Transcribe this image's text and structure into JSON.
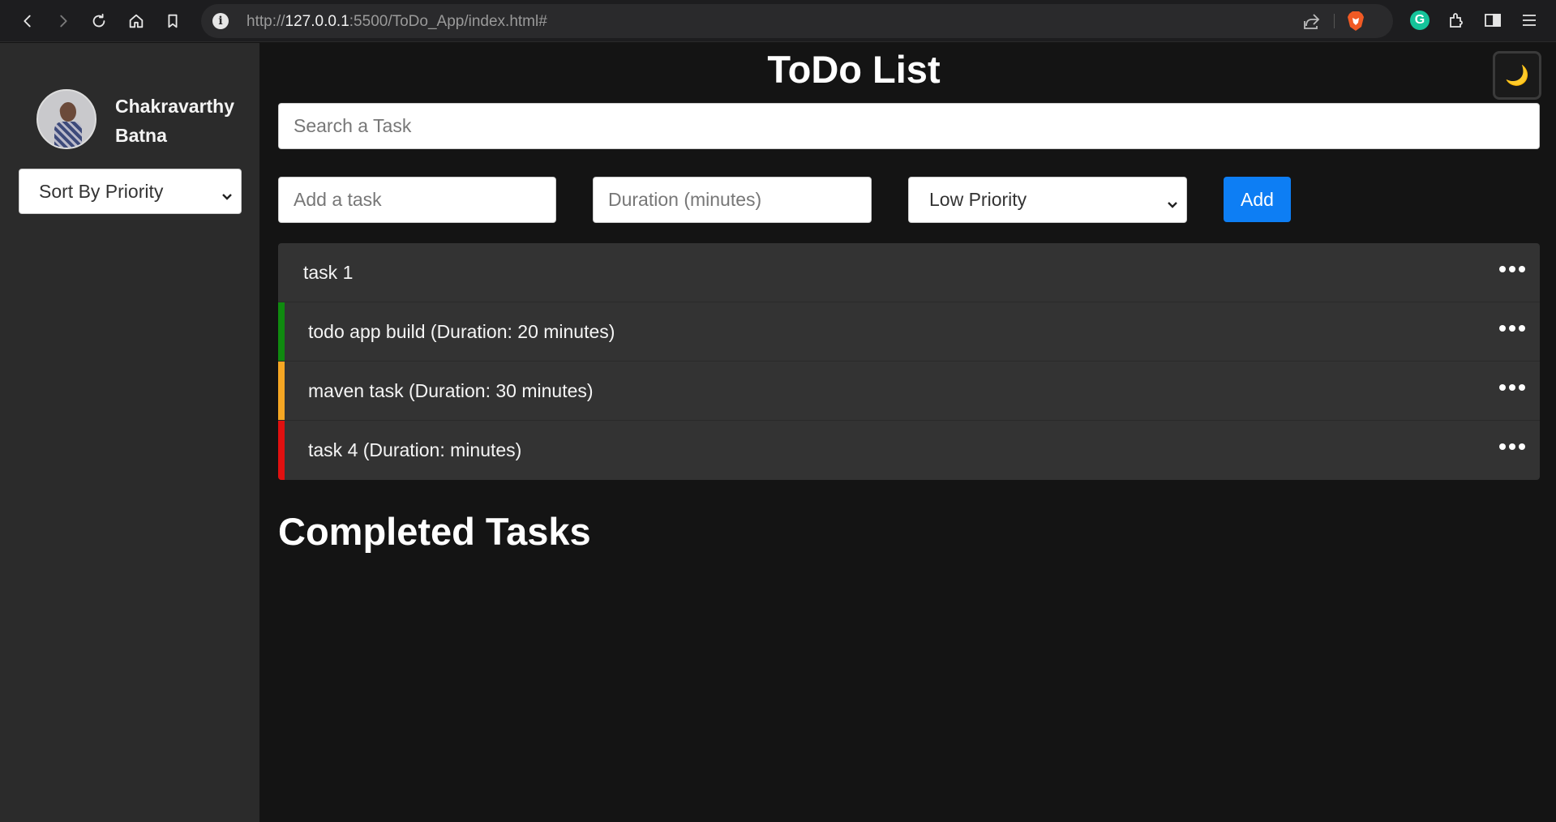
{
  "browser": {
    "url_prefix": "http://",
    "url_host": "127.0.0.1",
    "url_rest": ":5500/ToDo_App/index.html#"
  },
  "sidebar": {
    "user_name": "Chakravarthy Batna",
    "sort_select": "Sort By Priority"
  },
  "main": {
    "title": "ToDo List",
    "theme_toggle_icon": "🌙",
    "search_placeholder": "Search a Task",
    "task_placeholder": "Add a task",
    "duration_placeholder": "Duration (minutes)",
    "priority_select": "Low Priority",
    "add_label": "Add",
    "completed_title": "Completed Tasks"
  },
  "tasks": [
    {
      "label": "task 1",
      "priority": "none",
      "color": ""
    },
    {
      "label": "todo app build (Duration: 20 minutes)",
      "priority": "low",
      "color": "#0f8a0f"
    },
    {
      "label": "maven task (Duration: 30 minutes)",
      "priority": "medium",
      "color": "#f5a623"
    },
    {
      "label": "task 4 (Duration: minutes)",
      "priority": "high",
      "color": "#e01010"
    }
  ],
  "colors": {
    "accent": "#0d7ef4",
    "background": "#141414",
    "sidebar": "#2b2b2b",
    "task_bg": "#333333"
  }
}
